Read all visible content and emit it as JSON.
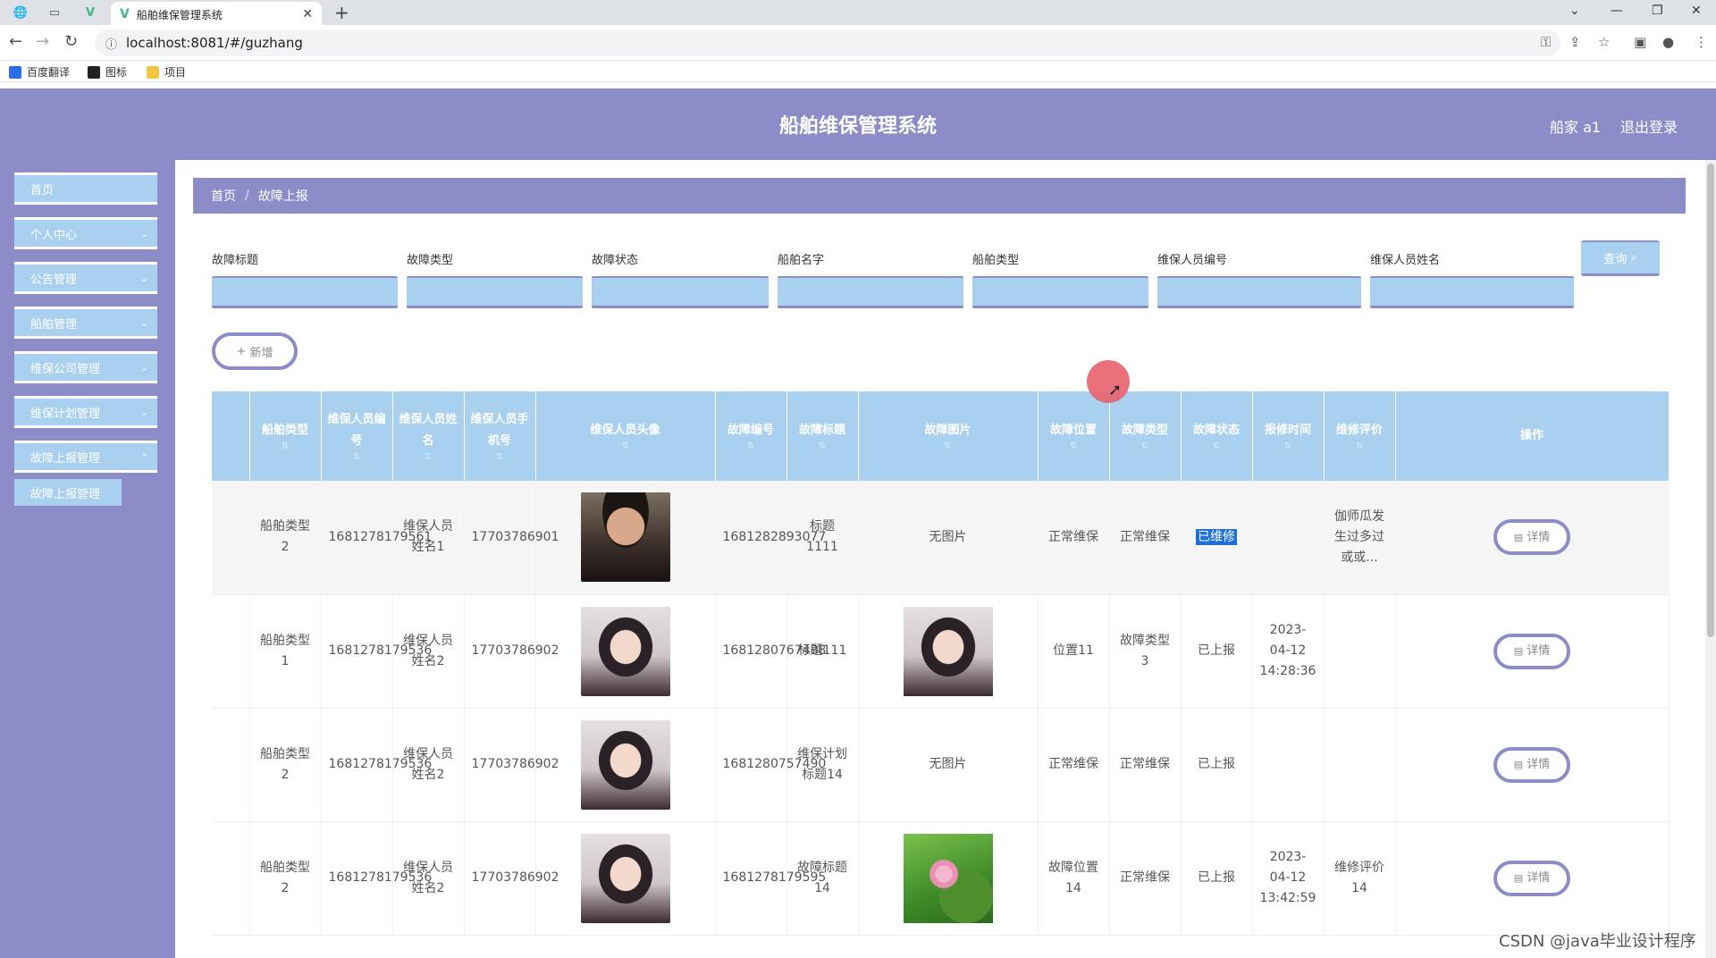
{
  "browser": {
    "tab_title": "船舶维保管理系统",
    "url": "localhost:8081/#/guzhang",
    "bookmarks": [
      "百度翻译",
      "图标",
      "项目"
    ]
  },
  "header": {
    "title": "船舶维保管理系统",
    "user": "船家 a1",
    "logout": "退出登录"
  },
  "sidebar": {
    "items": [
      {
        "label": "首页"
      },
      {
        "label": "个人中心"
      },
      {
        "label": "公告管理"
      },
      {
        "label": "船舶管理"
      },
      {
        "label": "维保公司管理"
      },
      {
        "label": "维保计划管理"
      },
      {
        "label": "故障上报管理"
      }
    ],
    "submenu": "故障上报管理"
  },
  "breadcrumb": {
    "home": "首页",
    "current": "故障上报"
  },
  "filters": [
    {
      "label": "故障标题"
    },
    {
      "label": "故障类型"
    },
    {
      "label": "故障状态"
    },
    {
      "label": "船舶名字"
    },
    {
      "label": "船舶类型"
    },
    {
      "label": "维保人员编号"
    },
    {
      "label": "维保人员姓名"
    }
  ],
  "search_label": "查询",
  "add_label": "新增",
  "table": {
    "headers": [
      "船舶类型",
      "维保人员编号",
      "维保人员姓名",
      "维保人员手机号",
      "维保人员头像",
      "故障编号",
      "故障标题",
      "故障图片",
      "故障位置",
      "故障类型",
      "故障状态",
      "报修时间",
      "维修评价",
      "操作"
    ],
    "rows": [
      {
        "ship_type": "船舶类型2",
        "staff_no": "1681278179561",
        "staff_name": "维保人员姓名1",
        "phone": "17703786901",
        "avatar": "male",
        "fault_no": "1681282893077",
        "fault_title": "标题1111",
        "fault_image": "无图片",
        "location": "正常维保",
        "fault_type": "正常维保",
        "status": "已维修",
        "report_time": "",
        "evaluation": "伽师瓜发生过多过或或...",
        "action": "详情"
      },
      {
        "ship_type": "船舶类型1",
        "staff_no": "1681278179536",
        "staff_name": "维保人员姓名2",
        "phone": "17703786902",
        "avatar": "female",
        "fault_no": "1681280767488",
        "fault_title": "标题111",
        "fault_image": "image-female",
        "location": "位置11",
        "fault_type": "故障类型3",
        "status": "已上报",
        "report_time": "2023-04-12 14:28:36",
        "evaluation": "",
        "action": "详情"
      },
      {
        "ship_type": "船舶类型2",
        "staff_no": "1681278179536",
        "staff_name": "维保人员姓名2",
        "phone": "17703786902",
        "avatar": "female",
        "fault_no": "1681280757490",
        "fault_title": "维保计划标题14",
        "fault_image": "无图片",
        "location": "正常维保",
        "fault_type": "正常维保",
        "status": "已上报",
        "report_time": "",
        "evaluation": "",
        "action": "详情"
      },
      {
        "ship_type": "船舶类型2",
        "staff_no": "1681278179536",
        "staff_name": "维保人员姓名2",
        "phone": "17703786902",
        "avatar": "female",
        "fault_no": "1681278179595",
        "fault_title": "故障标题14",
        "fault_image": "image-lotus",
        "location": "故障位置14",
        "fault_type": "正常维保",
        "status": "已上报",
        "report_time": "2023-04-12 13:42:59",
        "evaluation": "维修评价14",
        "action": "详情"
      }
    ]
  },
  "watermark": "CSDN @java毕业设计程序",
  "colors": {
    "header": "#8c8cc8",
    "accent": "#a9d1ef",
    "highlight": "#1e6fd9"
  }
}
